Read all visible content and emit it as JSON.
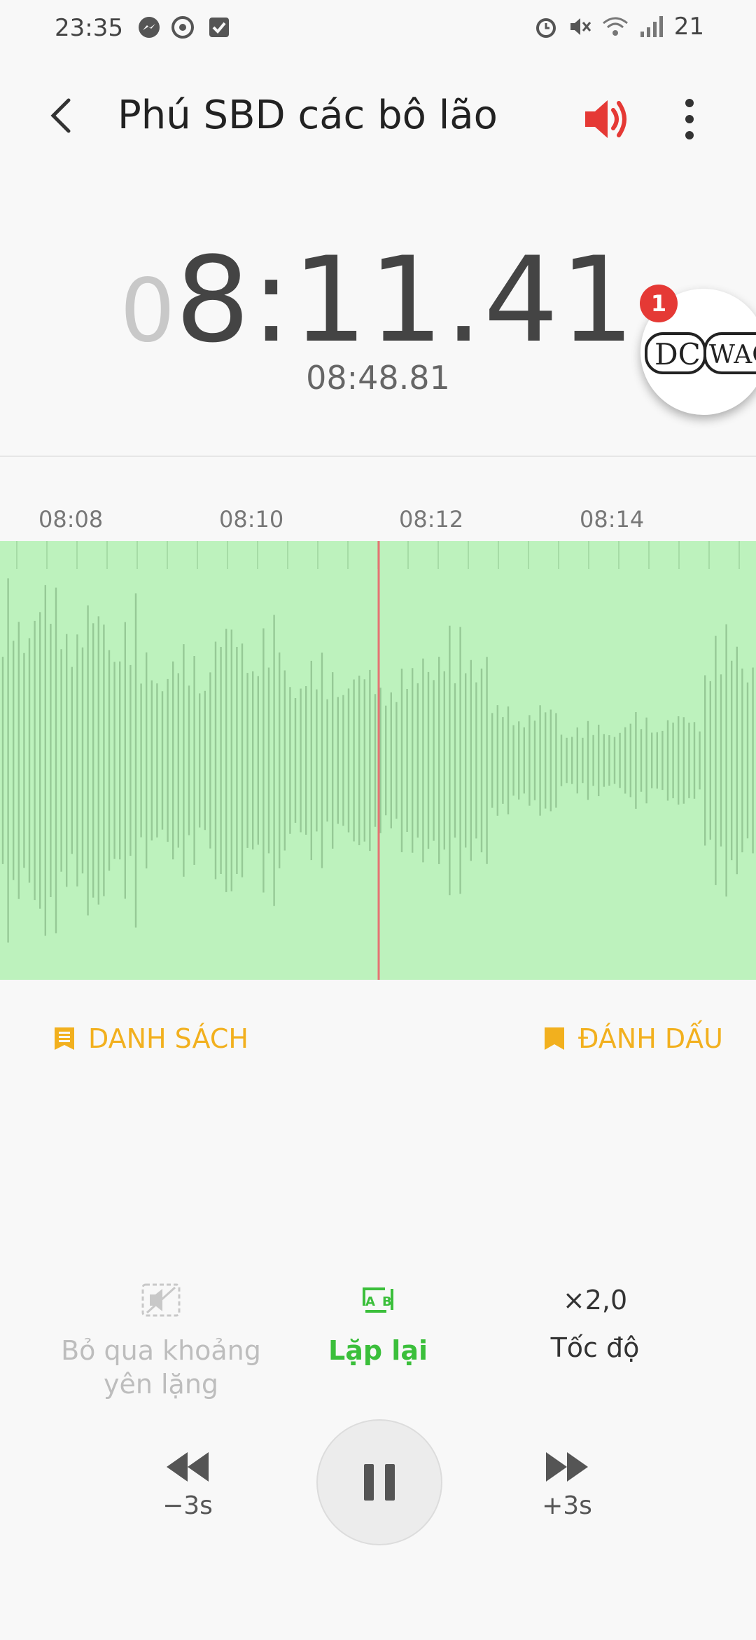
{
  "status_bar": {
    "time": "23:35",
    "icons_left": [
      "messenger-icon",
      "settings-icon",
      "checkbox-icon"
    ],
    "icons_right": [
      "alarm-icon",
      "mute-icon",
      "wifi-icon",
      "signal-icon"
    ],
    "battery": "21"
  },
  "header": {
    "title": "Phú SBD các bô lão",
    "back_icon": "back-arrow-icon",
    "speaker_icon": "speaker-icon",
    "more_icon": "more-vertical-icon"
  },
  "player": {
    "elapsed_dim": "0",
    "elapsed_main": "8:11.41",
    "total": "08:48.81"
  },
  "bubble": {
    "badge": "1",
    "logo_text": "DC WAC"
  },
  "timeline": {
    "labels": [
      "08:08",
      "08:10",
      "08:12",
      "08:14"
    ]
  },
  "actions": {
    "list_label": "DANH SÁCH",
    "bookmark_label": "ĐÁNH DẤU"
  },
  "controls": {
    "skip_silence_line1": "Bỏ qua khoảng",
    "skip_silence_line2": "yên lặng",
    "repeat_label": "Lặp lại",
    "speed_value": "×2,0",
    "speed_label": "Tốc độ",
    "rewind_label": "−3s",
    "forward_label": "+3s"
  },
  "colors": {
    "accent_yellow": "#f2b01e",
    "accent_green": "#3bbf3b",
    "waveform_bg": "#bdf2bd",
    "playhead": "#e57373",
    "speaker_red": "#e53935"
  }
}
